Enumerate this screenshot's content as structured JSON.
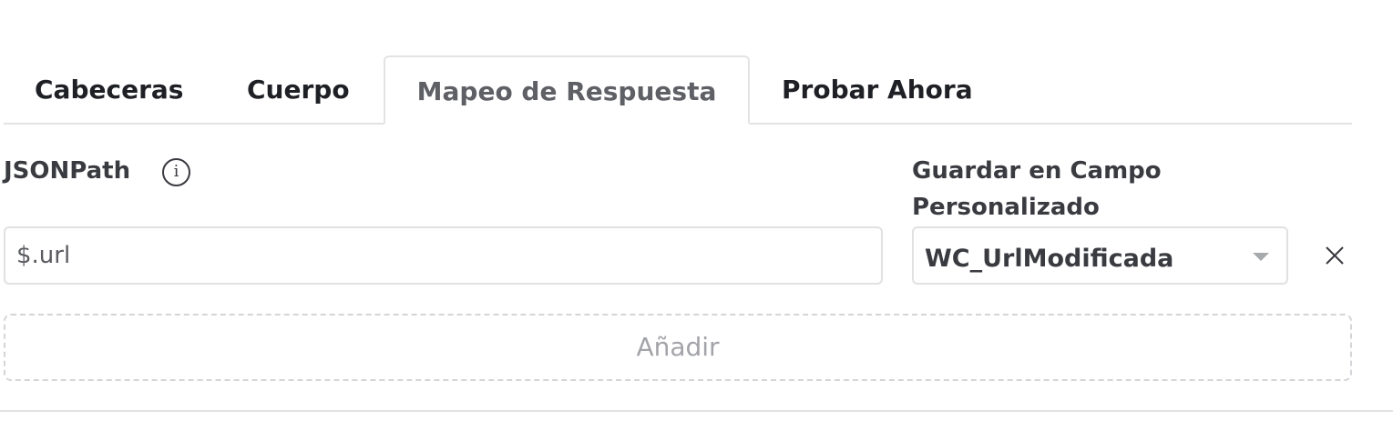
{
  "tabs": [
    {
      "label": "Cabeceras",
      "active": false
    },
    {
      "label": "Cuerpo",
      "active": false
    },
    {
      "label": "Mapeo de Respuesta",
      "active": true
    },
    {
      "label": "Probar Ahora",
      "active": false
    }
  ],
  "mapping": {
    "jsonpath_label": "JSONPath",
    "jsonpath_value": "$.url",
    "custom_field_label_line1": "Guardar en Campo",
    "custom_field_label_line2": "Personalizado",
    "custom_field_value": "WC_UrlModificada"
  },
  "icons": {
    "info": "info-icon",
    "dropdown": "chevron-down-icon",
    "remove": "close-icon"
  },
  "add_label": "Añadir",
  "colors": {
    "text": "#1f2025",
    "active_tab_text": "#5f6066",
    "border": "#e3e3e6",
    "add_text": "#a3a4a9"
  }
}
